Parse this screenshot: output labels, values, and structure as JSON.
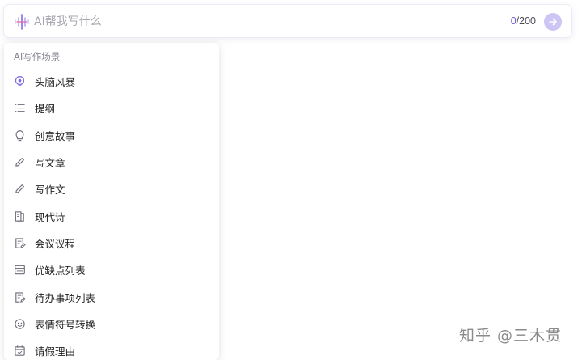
{
  "ai_bar": {
    "placeholder": "AI帮我写什么",
    "char_count": "0",
    "char_limit": "/200"
  },
  "dropdown": {
    "heading": "AI写作场景",
    "items": [
      {
        "label": "头脑风暴",
        "icon": "lightbulb-brain-icon"
      },
      {
        "label": "提纲",
        "icon": "outline-list-icon"
      },
      {
        "label": "创意故事",
        "icon": "idea-bulb-icon"
      },
      {
        "label": "写文章",
        "icon": "pen-icon"
      },
      {
        "label": "写作文",
        "icon": "pen-icon"
      },
      {
        "label": "现代诗",
        "icon": "book-icon"
      },
      {
        "label": "会议议程",
        "icon": "edit-document-icon"
      },
      {
        "label": "优缺点列表",
        "icon": "table-icon"
      },
      {
        "label": "待办事项列表",
        "icon": "edit-document-icon"
      },
      {
        "label": "表情符号转换",
        "icon": "smiley-icon"
      },
      {
        "label": "请假理由",
        "icon": "calendar-icon"
      }
    ]
  },
  "watermark": "知乎 @三木贯",
  "colors": {
    "accent": "#7b6ae0",
    "send_button": "#cdc5f3",
    "icon": "#6c6c78"
  }
}
